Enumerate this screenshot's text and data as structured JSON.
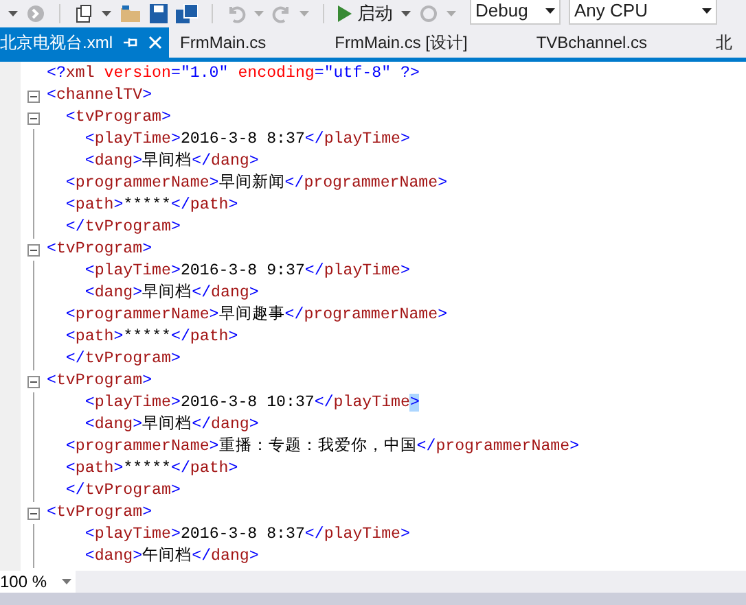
{
  "toolbar": {
    "start_label": "启动",
    "configuration": "Debug",
    "platform": "Any CPU"
  },
  "tabs": [
    {
      "label": "北京电视台.xml",
      "selected": true,
      "pinned": false
    },
    {
      "label": "FrmMain.cs",
      "selected": false
    },
    {
      "label": "FrmMain.cs [设计]",
      "selected": false
    },
    {
      "label": "TVBchannel.cs",
      "selected": false
    },
    {
      "label": "北",
      "selected": false
    }
  ],
  "editor": {
    "lines": [
      {
        "text": "<?xml version=\"1.0\" encoding=\"utf-8\" ?>"
      },
      {
        "text": "<channelTV>",
        "collapsible": true,
        "expanded": true
      },
      {
        "text": "  <tvProgram>",
        "collapsible": true,
        "expanded": true
      },
      {
        "text": "    <playTime>2016-3-8 8:37</playTime>"
      },
      {
        "text": "    <dang>早间档</dang>"
      },
      {
        "text": "  <programmerName>早间新闻</programmerName>"
      },
      {
        "text": "  <path>*****</path>"
      },
      {
        "text": "  </tvProgram>"
      },
      {
        "text": "<tvProgram>",
        "collapsible": true,
        "expanded": true
      },
      {
        "text": "    <playTime>2016-3-8 9:37</playTime>"
      },
      {
        "text": "    <dang>早间档</dang>"
      },
      {
        "text": "  <programmerName>早间趣事</programmerName>"
      },
      {
        "text": "  <path>*****</path>"
      },
      {
        "text": "  </tvProgram>"
      },
      {
        "text": "<tvProgram>",
        "collapsible": true,
        "expanded": true
      },
      {
        "text": "    <playTime>2016-3-8 10:37</playTime>",
        "brace_match_end": true
      },
      {
        "text": "    <dang>早间档</dang>"
      },
      {
        "text": "  <programmerName>重播：专题：我爱你，中国</programmerName>"
      },
      {
        "text": "  <path>*****</path>"
      },
      {
        "text": "  </tvProgram>"
      },
      {
        "text": "<tvProgram>",
        "collapsible": true,
        "expanded": true
      },
      {
        "text": "    <playTime>2016-3-8 8:37</playTime>"
      },
      {
        "text": "    <dang>午间档</dang>"
      }
    ]
  },
  "zoom": "100 %"
}
